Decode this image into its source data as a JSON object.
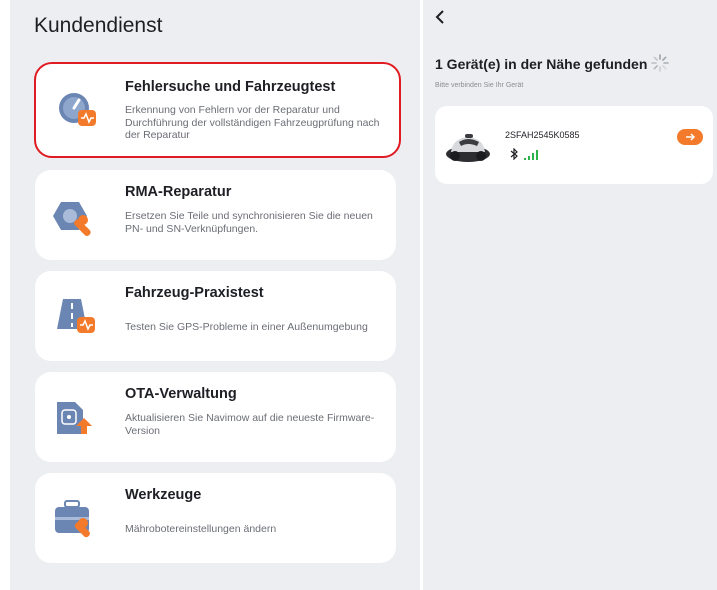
{
  "left_panel": {
    "title": "Kundendienst",
    "cards": [
      {
        "title": "Fehlersuche und Fahrzeugtest",
        "desc": "Erkennung von Fehlern vor der Reparatur und Durchführung der vollständigen Fahrzeugprüfung nach der Reparatur",
        "icon": "diagnostic-gauge-icon",
        "selected": true
      },
      {
        "title": "RMA-Reparatur",
        "desc": "Ersetzen Sie Teile und synchronisieren Sie die neuen PN- und SN-Verknüpfungen.",
        "icon": "repair-nut-wrench-icon",
        "selected": false
      },
      {
        "title": "Fahrzeug-Praxistest",
        "desc": "Testen Sie GPS-Probleme in einer Außenumgebung",
        "icon": "road-test-icon",
        "selected": false
      },
      {
        "title": "OTA-Verwaltung",
        "desc": "Aktualisieren Sie Navimow auf die neueste Firmware-Version",
        "icon": "firmware-upload-icon",
        "selected": false
      },
      {
        "title": "Werkzeuge",
        "desc": "Mährobotereinstellungen ändern",
        "icon": "toolbox-icon",
        "selected": false
      }
    ]
  },
  "right_panel": {
    "back_icon": "chevron-left-icon",
    "found_text": "1 Gerät(e) in der Nähe gefunden",
    "hint": "Bitte verbinden Sie Ihr Gerät",
    "device": {
      "name": "2SFAH2545K0585",
      "icons": [
        "bluetooth-icon",
        "signal-strength-icon",
        "arrow-right-icon"
      ]
    }
  },
  "colors": {
    "accent_orange": "#f37a2a",
    "selected_border": "#e11b22",
    "icon_blue": "#6b86b3",
    "signal_green": "#2bb34a"
  }
}
